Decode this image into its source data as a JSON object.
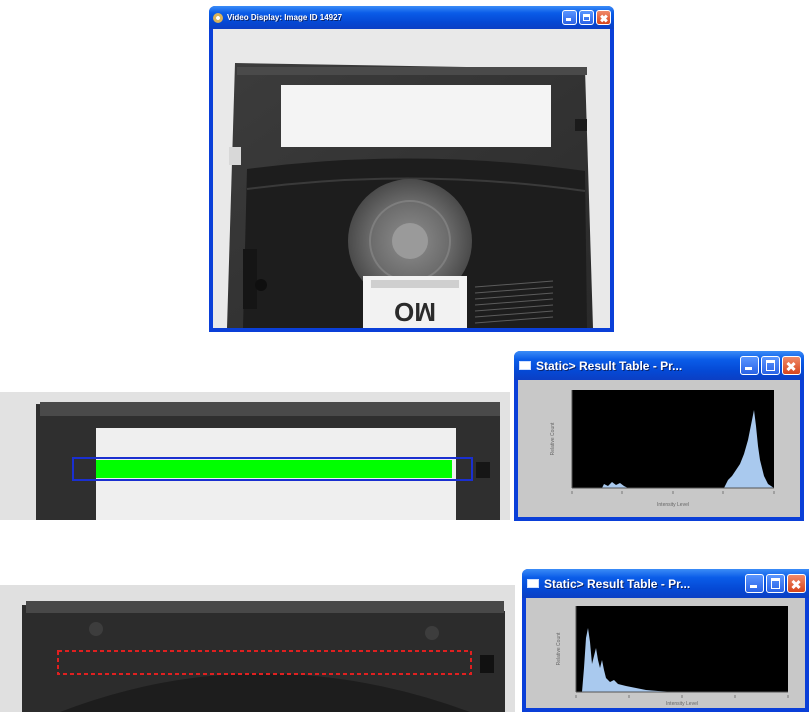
{
  "video_window": {
    "title": "Video Display: Image ID 14927",
    "disk_label_text": "MO"
  },
  "histogram_windows": [
    {
      "title": "Static> Result Table - Pr...",
      "y_axis_label": "Relative Count",
      "x_axis_label": "Intensity Level"
    },
    {
      "title": "Static> Result Table - Pr...",
      "y_axis_label": "Relative Count",
      "x_axis_label": "Intensity Level"
    }
  ],
  "regions_of_interest": [
    {
      "name": "bright-label-roi",
      "outline_color": "#1a2fd0",
      "fill_color": "#00ff00",
      "style": "solid"
    },
    {
      "name": "dark-no-label-roi",
      "outline_color": "#e02020",
      "style": "dashed"
    }
  ],
  "colors": {
    "xp_title_blue": "#0548d4",
    "histogram_plot_bg": "#000000",
    "histogram_bars": "#a9c9ee",
    "histogram_panel": "#c8c8c8"
  }
}
